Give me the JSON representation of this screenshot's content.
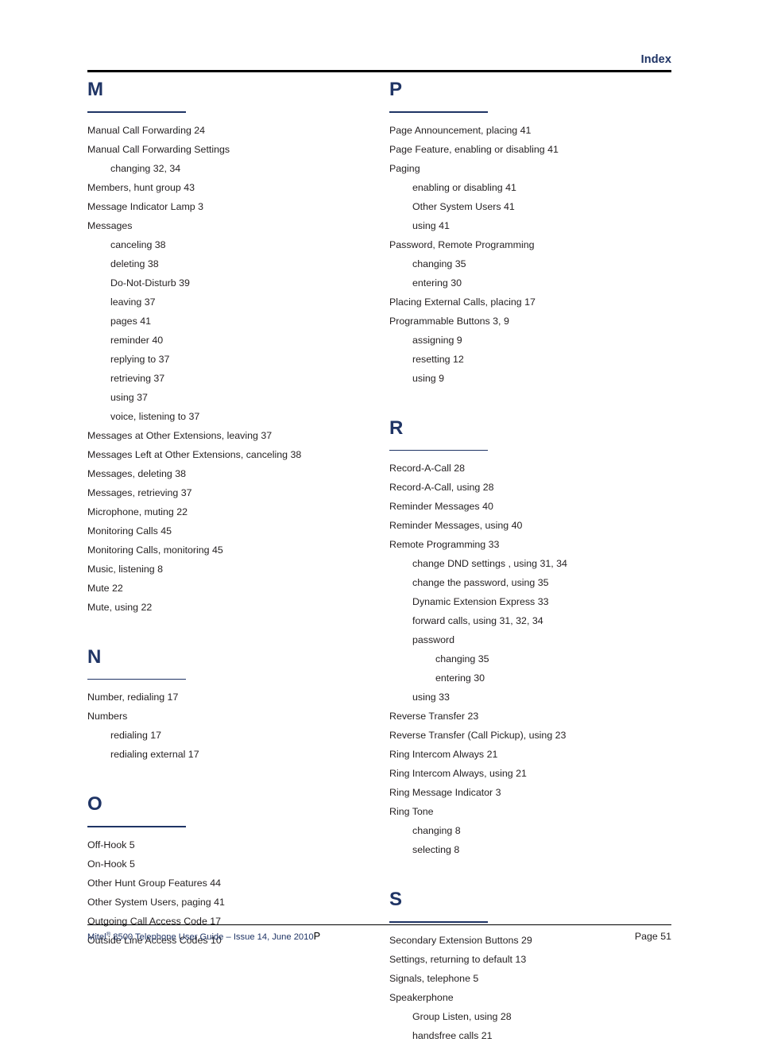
{
  "header": {
    "title": "Index"
  },
  "columns": {
    "left": [
      {
        "letter": "M",
        "entries": [
          {
            "level": 0,
            "text": "Manual Call Forwarding  24"
          },
          {
            "level": 0,
            "text": "Manual Call Forwarding Settings"
          },
          {
            "level": 1,
            "text": "changing  32,  34"
          },
          {
            "level": 0,
            "text": "Members, hunt group  43"
          },
          {
            "level": 0,
            "text": "Message Indicator Lamp  3"
          },
          {
            "level": 0,
            "text": "Messages"
          },
          {
            "level": 1,
            "text": "canceling  38"
          },
          {
            "level": 1,
            "text": "deleting  38"
          },
          {
            "level": 1,
            "text": "Do-Not-Disturb  39"
          },
          {
            "level": 1,
            "text": "leaving  37"
          },
          {
            "level": 1,
            "text": "pages  41"
          },
          {
            "level": 1,
            "text": "reminder  40"
          },
          {
            "level": 1,
            "text": "replying to  37"
          },
          {
            "level": 1,
            "text": "retrieving  37"
          },
          {
            "level": 1,
            "text": "using  37"
          },
          {
            "level": 1,
            "text": "voice, listening to  37"
          },
          {
            "level": 0,
            "text": "Messages at Other Extensions, leaving  37"
          },
          {
            "level": 0,
            "text": "Messages Left at Other Extensions, canceling  38"
          },
          {
            "level": 0,
            "text": "Messages, deleting  38"
          },
          {
            "level": 0,
            "text": "Messages, retrieving  37"
          },
          {
            "level": 0,
            "text": "Microphone, muting  22"
          },
          {
            "level": 0,
            "text": "Monitoring Calls  45"
          },
          {
            "level": 0,
            "text": "Monitoring Calls, monitoring  45"
          },
          {
            "level": 0,
            "text": "Music, listening  8"
          },
          {
            "level": 0,
            "text": "Mute  22"
          },
          {
            "level": 0,
            "text": "Mute, using  22"
          }
        ]
      },
      {
        "letter": "N",
        "entries": [
          {
            "level": 0,
            "text": "Number, redialing  17"
          },
          {
            "level": 0,
            "text": "Numbers"
          },
          {
            "level": 1,
            "text": "redialing  17"
          },
          {
            "level": 1,
            "text": "redialing external  17"
          }
        ]
      },
      {
        "letter": "O",
        "entries": [
          {
            "level": 0,
            "text": "Off-Hook  5"
          },
          {
            "level": 0,
            "text": "On-Hook  5"
          },
          {
            "level": 0,
            "text": "Other Hunt Group Features  44"
          },
          {
            "level": 0,
            "text": "Other System Users, paging  41"
          },
          {
            "level": 0,
            "text": "Outgoing Call Access Code  17"
          },
          {
            "level": 0,
            "text": "Outside Line Access Codes  10"
          }
        ]
      }
    ],
    "right": [
      {
        "letter": "P",
        "entries": [
          {
            "level": 0,
            "text": "Page Announcement, placing  41"
          },
          {
            "level": 0,
            "text": "Page Feature, enabling or disabling  41"
          },
          {
            "level": 0,
            "text": "Paging"
          },
          {
            "level": 1,
            "text": "enabling or disabling  41"
          },
          {
            "level": 1,
            "text": "Other System Users  41"
          },
          {
            "level": 1,
            "text": "using  41"
          },
          {
            "level": 0,
            "text": "Password, Remote Programming"
          },
          {
            "level": 1,
            "text": "changing  35"
          },
          {
            "level": 1,
            "text": "entering  30"
          },
          {
            "level": 0,
            "text": "Placing External Calls, placing  17"
          },
          {
            "level": 0,
            "text": "Programmable Buttons  3,  9"
          },
          {
            "level": 1,
            "text": "assigning  9"
          },
          {
            "level": 1,
            "text": "resetting  12"
          },
          {
            "level": 1,
            "text": "using  9"
          }
        ]
      },
      {
        "letter": "R",
        "entries": [
          {
            "level": 0,
            "text": "Record-A-Call  28"
          },
          {
            "level": 0,
            "text": "Record-A-Call, using  28"
          },
          {
            "level": 0,
            "text": "Reminder Messages  40"
          },
          {
            "level": 0,
            "text": "Reminder Messages, using  40"
          },
          {
            "level": 0,
            "text": "Remote Programming  33"
          },
          {
            "level": 1,
            "text": "change DND settings , using  31,  34"
          },
          {
            "level": 1,
            "text": "change the password, using  35"
          },
          {
            "level": 1,
            "text": "Dynamic Extension Express  33"
          },
          {
            "level": 1,
            "text": "forward calls, using  31,  32,  34"
          },
          {
            "level": 1,
            "text": "password"
          },
          {
            "level": 2,
            "text": "changing  35"
          },
          {
            "level": 2,
            "text": "entering  30"
          },
          {
            "level": 1,
            "text": "using  33"
          },
          {
            "level": 0,
            "text": "Reverse Transfer  23"
          },
          {
            "level": 0,
            "text": "Reverse Transfer (Call Pickup), using  23"
          },
          {
            "level": 0,
            "text": "Ring Intercom Always  21"
          },
          {
            "level": 0,
            "text": "Ring Intercom Always, using  21"
          },
          {
            "level": 0,
            "text": "Ring Message Indicator  3"
          },
          {
            "level": 0,
            "text": "Ring Tone"
          },
          {
            "level": 1,
            "text": "changing  8"
          },
          {
            "level": 1,
            "text": "selecting  8"
          }
        ]
      },
      {
        "letter": "S",
        "entries": [
          {
            "level": 0,
            "text": "Secondary Extension Buttons  29"
          },
          {
            "level": 0,
            "text": "Settings, returning to default  13"
          },
          {
            "level": 0,
            "text": "Signals, telephone  5"
          },
          {
            "level": 0,
            "text": "Speakerphone"
          },
          {
            "level": 1,
            "text": "Group Listen, using  28"
          },
          {
            "level": 1,
            "text": "handsfree calls  21"
          }
        ]
      }
    ]
  },
  "footer": {
    "product": "Mitel",
    "registered_mark": "®",
    "guide_text": " 8500 Telephone User Guide – Issue 14, June 2010",
    "trailing_char": "P",
    "page_label": "Page 51"
  },
  "colors": {
    "heading_blue": "#1f3465",
    "body_text": "#231f20",
    "rule_black": "#000000"
  }
}
